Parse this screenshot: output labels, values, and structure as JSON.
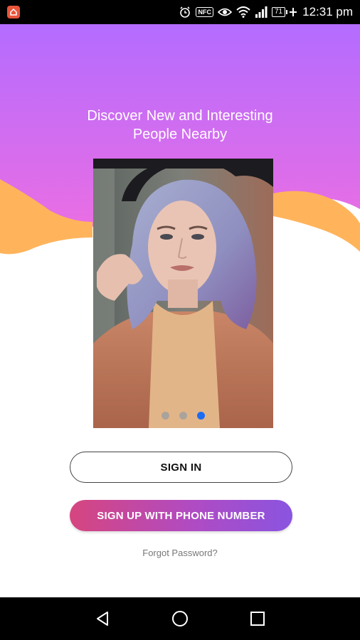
{
  "status_bar": {
    "battery": "71",
    "nfc": "NFC",
    "time": "12:31 pm",
    "icons": [
      "app-notification-icon",
      "alarm-icon",
      "nfc-icon",
      "eye-icon",
      "wifi-icon",
      "signal-icon",
      "battery-icon",
      "charging-icon"
    ]
  },
  "hero": {
    "tagline_line1": "Discover New and Interesting",
    "tagline_line2": "People Nearby",
    "gradient_top": "#b46cff",
    "gradient_bottom": "#f06ee0",
    "wave_color": "#ffb45c"
  },
  "carousel": {
    "slide_count": 3,
    "active_index": 2,
    "active_color": "#1e6cf2"
  },
  "actions": {
    "sign_in_label": "SIGN IN",
    "sign_up_label": "SIGN UP WITH PHONE NUMBER",
    "forgot_label": "Forgot Password?"
  },
  "nav_bar": {
    "icons": [
      "back-icon",
      "home-icon",
      "recents-icon"
    ]
  }
}
